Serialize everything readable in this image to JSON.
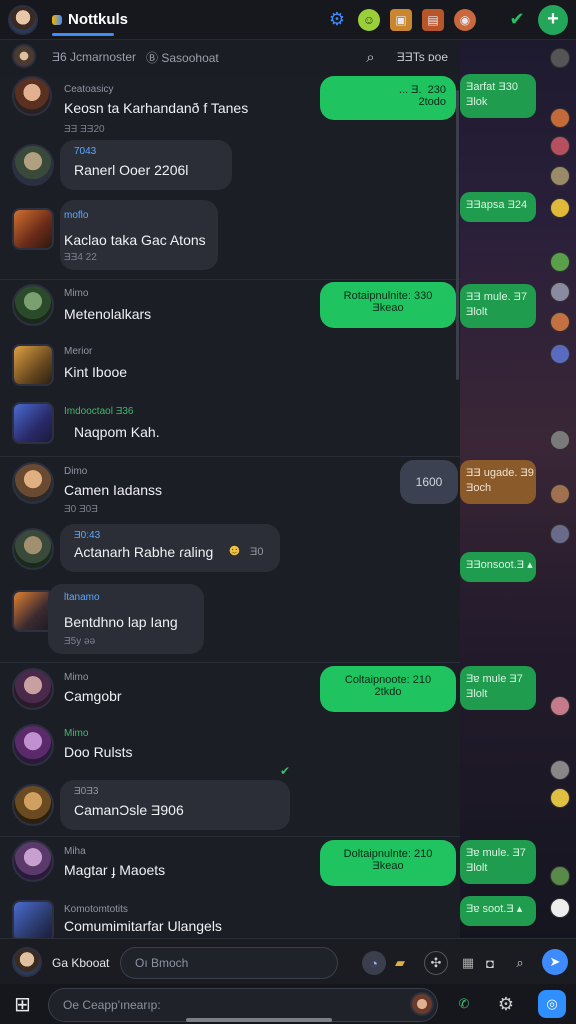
{
  "topbar": {
    "title": "Nottkuls",
    "icons": [
      "gear-icon",
      "smiley-icon",
      "game-icon",
      "store-icon",
      "profile-icon",
      "check-icon"
    ],
    "fab_label": "+"
  },
  "subbar": {
    "item1": "Ǝ6 Jcmarnoster",
    "item2": "Ⓑ Sasoohoat",
    "search_icon": "⌕",
    "right_label": "ƎƎTs ᴅoe"
  },
  "chats": [
    {
      "meta": "Ceatoasicy",
      "text": "Keosn ta Karhandanð f Tanes",
      "time": "ƎƎ ƎƎ20",
      "out": "... Ǝ.  230\n2todo"
    },
    {
      "meta": "7043",
      "text": "Ranerl Ooer 2206l",
      "time": ""
    },
    {
      "meta": "moflo",
      "text": "Kaclao taka Gac Atons",
      "time": "ƎƎ4 22"
    },
    {
      "meta": "Mimo",
      "text": "Metenolalkars",
      "time": "",
      "out": "Rotaipnulnite: 330\nƎkeao"
    },
    {
      "meta": "Merior",
      "text": "Kint Ibooe",
      "time": ""
    },
    {
      "meta": "Imdooctaol Ǝ36",
      "text": "Naqpom Kah.",
      "time": ""
    },
    {
      "meta": "Dimo",
      "text": "Camen Iadanss",
      "time": "Ǝ0 Ǝ0Ǝ",
      "out_grey": "1600"
    },
    {
      "meta": "Ǝ0:43",
      "text": "Actanarh Rabhe ɾaling",
      "time": "",
      "emoji_trail": "Ǝ0"
    },
    {
      "meta": "Ɩtanamo",
      "text": "Bentdhno lap Iang",
      "time": "Ǝ5y ǝǝ"
    },
    {
      "meta": "Mimo",
      "text": "Camgobr",
      "time": "",
      "out": "Coltaipnoote: 210\n2tkdo"
    },
    {
      "meta": "Mimo",
      "text": "Doo Rulsts",
      "time": ""
    },
    {
      "meta": "Ǝ0Ǝ3",
      "text": "CamanƆsle Ǝ906",
      "time": ""
    },
    {
      "meta": "Miha",
      "text": "Magtar ɟ Maoets",
      "time": "",
      "out": "Doltaipnulnte: 210\nƎkeao"
    },
    {
      "meta": "Komotomtotits",
      "text": "Comumimitarfar Ulangels",
      "time": ""
    }
  ],
  "right_panel": {
    "bubbles": [
      "Ǝarfat Ǝ30\nƎlok",
      "ƎƎapsa Ǝ24",
      "ƎƎ mule. Ǝ7\nƎlolt",
      "ƎƎ ugade. Ǝ9\nƎoch",
      "ƎƎonsoot.Ǝ ▴",
      "Ǝɐ mule Ǝ7\nƎlolt",
      "Ǝɐ mule. Ǝ7\nƎlolt",
      "Ǝɐ soot.Ǝ ▴"
    ]
  },
  "compose": {
    "user_label": "Ga Kbooat",
    "search_placeholder": "Oı Bmoch",
    "message_placeholder": "Oe Ceapp'ınearıp:"
  },
  "colors": {
    "accent": "#3d8bff",
    "green": "#1fc35f",
    "bg": "#1c1e25"
  }
}
